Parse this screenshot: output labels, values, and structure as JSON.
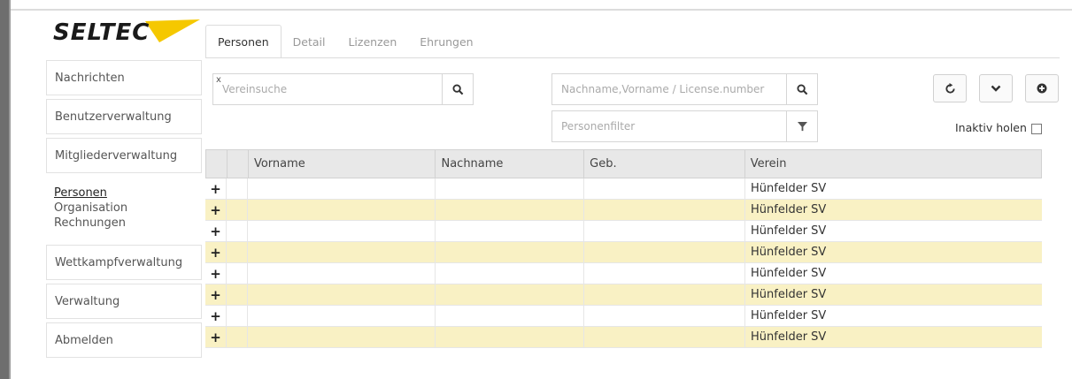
{
  "app": {
    "logo_text": "SELTEC",
    "accent_color": "#f5c800"
  },
  "tabs": [
    {
      "label": "Personen",
      "active": true
    },
    {
      "label": "Detail",
      "active": false
    },
    {
      "label": "Lizenzen",
      "active": false
    },
    {
      "label": "Ehrungen",
      "active": false
    }
  ],
  "sidebar": {
    "items": [
      {
        "label": "Nachrichten"
      },
      {
        "label": "Benutzerverwaltung"
      },
      {
        "label": "Mitgliederverwaltung"
      },
      {
        "label": "Wettkampfverwaltung"
      },
      {
        "label": "Verwaltung"
      },
      {
        "label": "Abmelden"
      }
    ],
    "subitems": [
      {
        "label": "Personen",
        "active": true
      },
      {
        "label": "Organisation",
        "active": false
      },
      {
        "label": "Rechnungen",
        "active": false
      }
    ]
  },
  "search": {
    "club_clear": "x",
    "club_placeholder": "Vereinsuche",
    "name_placeholder": "Nachname,Vorname / License.number",
    "filter_placeholder": "Personenfilter"
  },
  "icons": {
    "search": "search-icon",
    "filter": "filter-icon",
    "refresh": "refresh-icon",
    "expand": "chevron-down-icon",
    "add": "add-circle-icon",
    "row_expand": "plus-icon"
  },
  "inactive_label": "Inaktiv holen",
  "table": {
    "headers": [
      "Vorname",
      "Nachname",
      "Geb.",
      "Verein"
    ],
    "row_marker": "+",
    "rows": [
      {
        "verein": "Hünfelder SV"
      },
      {
        "verein": "Hünfelder SV"
      },
      {
        "verein": "Hünfelder SV"
      },
      {
        "verein": "Hünfelder SV"
      },
      {
        "verein": "Hünfelder SV"
      },
      {
        "verein": "Hünfelder SV"
      },
      {
        "verein": "Hünfelder SV"
      },
      {
        "verein": "Hünfelder SV"
      }
    ]
  }
}
